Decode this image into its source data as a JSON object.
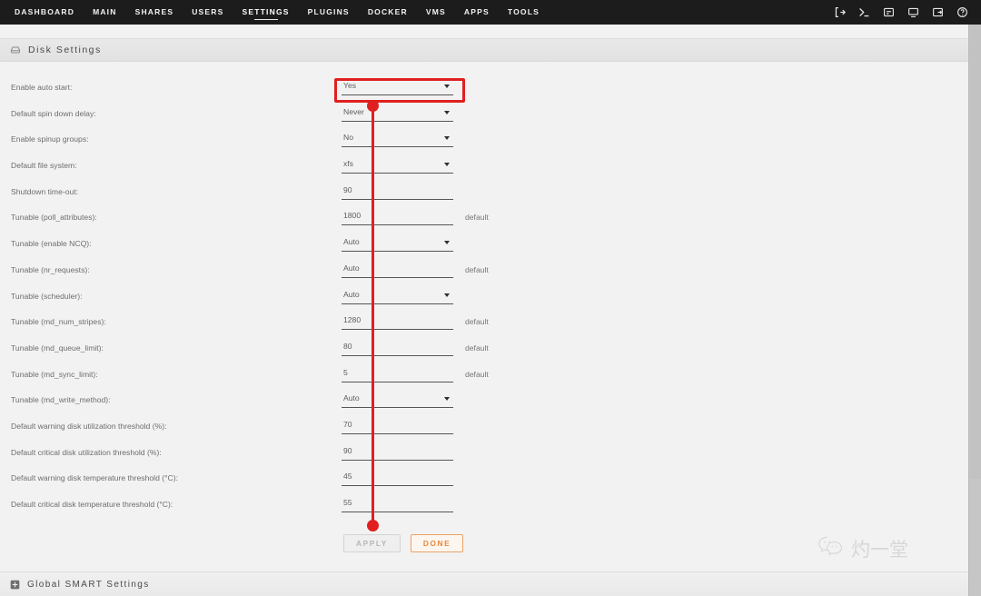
{
  "nav": {
    "items": [
      {
        "label": "DASHBOARD",
        "active": false
      },
      {
        "label": "MAIN",
        "active": false
      },
      {
        "label": "SHARES",
        "active": false
      },
      {
        "label": "USERS",
        "active": false
      },
      {
        "label": "SETTINGS",
        "active": true
      },
      {
        "label": "PLUGINS",
        "active": false
      },
      {
        "label": "DOCKER",
        "active": false
      },
      {
        "label": "VMS",
        "active": false
      },
      {
        "label": "APPS",
        "active": false
      },
      {
        "label": "TOOLS",
        "active": false
      }
    ],
    "icons": [
      {
        "name": "logout-icon"
      },
      {
        "name": "terminal-icon"
      },
      {
        "name": "log-icon"
      },
      {
        "name": "display-icon"
      },
      {
        "name": "archive-icon"
      },
      {
        "name": "help-icon"
      }
    ]
  },
  "header": {
    "icon": "disk-icon",
    "title": "Disk Settings"
  },
  "footer": {
    "icon": "expand-plus-icon",
    "title": "Global SMART Settings"
  },
  "form": {
    "rows": [
      {
        "label": "Enable auto start:",
        "value": "Yes",
        "type": "select",
        "hint": ""
      },
      {
        "label": "Default spin down delay:",
        "value": "Never",
        "type": "select",
        "hint": ""
      },
      {
        "label": "Enable spinup groups:",
        "value": "No",
        "type": "select",
        "hint": ""
      },
      {
        "label": "Default file system:",
        "value": "xfs",
        "type": "select",
        "hint": ""
      },
      {
        "label": "Shutdown time-out:",
        "value": "90",
        "type": "text",
        "hint": ""
      },
      {
        "label": "Tunable (poll_attributes):",
        "value": "1800",
        "type": "text",
        "hint": "default"
      },
      {
        "label": "Tunable (enable NCQ):",
        "value": "Auto",
        "type": "select",
        "hint": ""
      },
      {
        "label": "Tunable (nr_requests):",
        "value": "Auto",
        "type": "text",
        "hint": "default"
      },
      {
        "label": "Tunable (scheduler):",
        "value": "Auto",
        "type": "select",
        "hint": ""
      },
      {
        "label": "Tunable (md_num_stripes):",
        "value": "1280",
        "type": "text",
        "hint": "default"
      },
      {
        "label": "Tunable (md_queue_limit):",
        "value": "80",
        "type": "text",
        "hint": "default"
      },
      {
        "label": "Tunable (md_sync_limit):",
        "value": "5",
        "type": "text",
        "hint": "default"
      },
      {
        "label": "Tunable (md_write_method):",
        "value": "Auto",
        "type": "select",
        "hint": ""
      },
      {
        "label": "Default warning disk utilization threshold (%):",
        "value": "70",
        "type": "text",
        "hint": ""
      },
      {
        "label": "Default critical disk utilization threshold (%):",
        "value": "90",
        "type": "text",
        "hint": ""
      },
      {
        "label": "Default warning disk temperature threshold (°C):",
        "value": "45",
        "type": "text",
        "hint": ""
      },
      {
        "label": "Default critical disk temperature threshold (°C):",
        "value": "55",
        "type": "text",
        "hint": ""
      }
    ]
  },
  "buttons": {
    "apply_label": "APPLY",
    "done_label": "DONE"
  },
  "watermark": {
    "icon": "wechat-icon",
    "text": "灼一堂"
  },
  "annotation": {
    "color": "#e02020",
    "target": "Enable auto start"
  }
}
